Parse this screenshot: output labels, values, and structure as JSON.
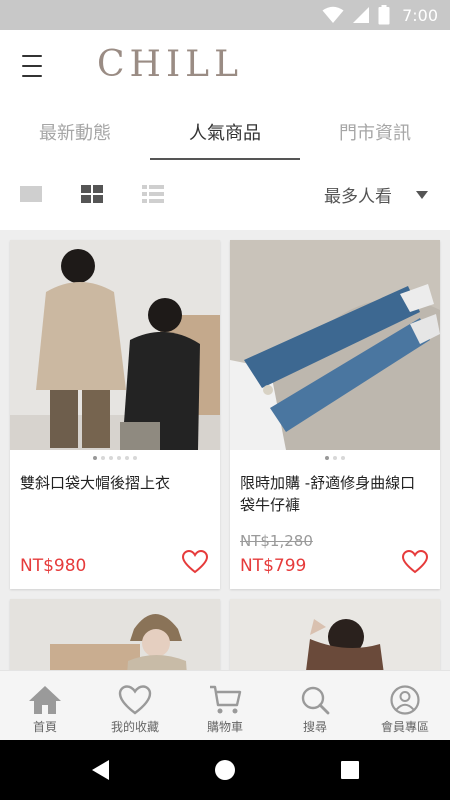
{
  "status_bar": {
    "time": "7:00"
  },
  "header": {
    "logo": "CHILL",
    "menu_icon": "hamburger-menu-icon"
  },
  "tabs": [
    {
      "label": "最新動態",
      "active": false
    },
    {
      "label": "人氣商品",
      "active": true
    },
    {
      "label": "門市資訊",
      "active": false
    }
  ],
  "view_bar": {
    "views": [
      "single-column-view-icon",
      "grid-view-icon",
      "list-view-icon"
    ],
    "selected_view": "grid-view-icon",
    "sort_label": "最多人看"
  },
  "products": [
    {
      "title": "雙斜口袋大帽後摺上衣",
      "old_price": "",
      "price": "NT$980",
      "favorited": false
    },
    {
      "title": "限時加購 -舒適修身曲線口袋牛仔褲",
      "old_price": "NT$1,280",
      "price": "NT$799",
      "favorited": false
    },
    {
      "title": "",
      "old_price": "",
      "price": "",
      "favorited": false
    },
    {
      "title": "",
      "old_price": "",
      "price": "",
      "favorited": false
    }
  ],
  "bottom_nav": [
    {
      "label": "首頁",
      "icon": "home-icon",
      "active": true
    },
    {
      "label": "我的收藏",
      "icon": "heart-icon",
      "active": false
    },
    {
      "label": "購物車",
      "icon": "cart-icon",
      "active": false
    },
    {
      "label": "搜尋",
      "icon": "search-icon",
      "active": false
    },
    {
      "label": "會員專區",
      "icon": "user-icon",
      "active": false
    }
  ],
  "colors": {
    "accent_red": "#e63b3b",
    "logo": "#9a8c84",
    "status_bar": "#c8c8c8"
  }
}
